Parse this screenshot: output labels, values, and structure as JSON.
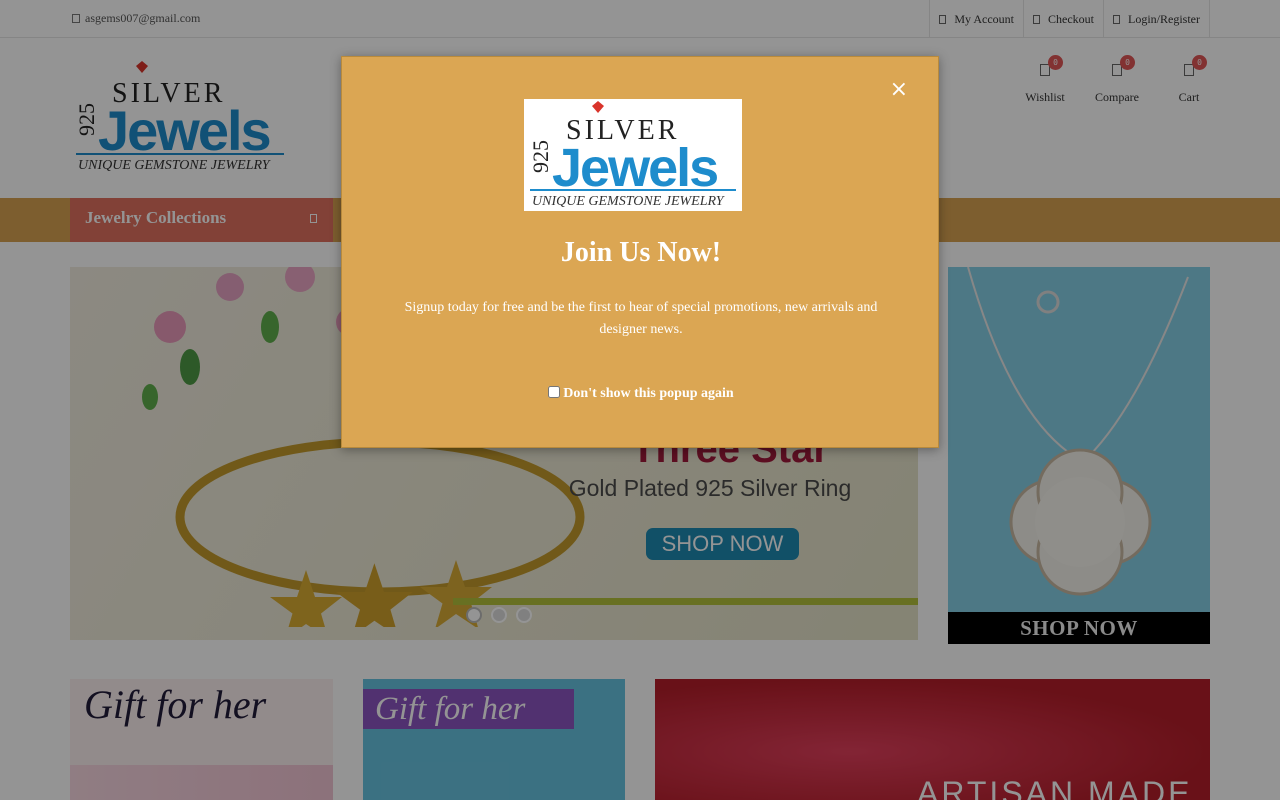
{
  "topbar": {
    "email": "asgems007@gmail.com",
    "links": [
      "My Account",
      "Checkout",
      "Login/Register"
    ]
  },
  "logo": {
    "top": "SILVER",
    "number": "925",
    "main": "Jewels",
    "tagline": "UNIQUE GEMSTONE JEWELRY"
  },
  "header_icons": [
    {
      "label": "Wishlist",
      "count": "0",
      "icon": "heart-icon"
    },
    {
      "label": "Compare",
      "count": "0",
      "icon": "compare-icon"
    },
    {
      "label": "Cart",
      "count": "0",
      "icon": "cart-icon"
    }
  ],
  "nav": {
    "collections_label": "Jewelry Collections",
    "icon": "menu-icon"
  },
  "slider": {
    "title": "Three Star",
    "subtitle": "Gold Plated 925 Silver Ring",
    "button": "SHOP NOW",
    "slide_count": 3,
    "active_slide": 1
  },
  "right_banner": {
    "button": "SHOP NOW"
  },
  "tiles": {
    "gift1": "Gift for her",
    "gift2": "Gift for her",
    "artisan": "ARTISAN MADE"
  },
  "popup": {
    "heading": "Join Us Now!",
    "description": "Signup today for free and be the first to hear of special promotions, new arrivals and designer news.",
    "dont_show": "Don't show this popup again",
    "close": "×"
  },
  "colors": {
    "gold": "#d7a351",
    "coral": "#e07060",
    "popup": "#dba653",
    "badge": "#e05656",
    "logo_blue": "#1e8ccc"
  }
}
